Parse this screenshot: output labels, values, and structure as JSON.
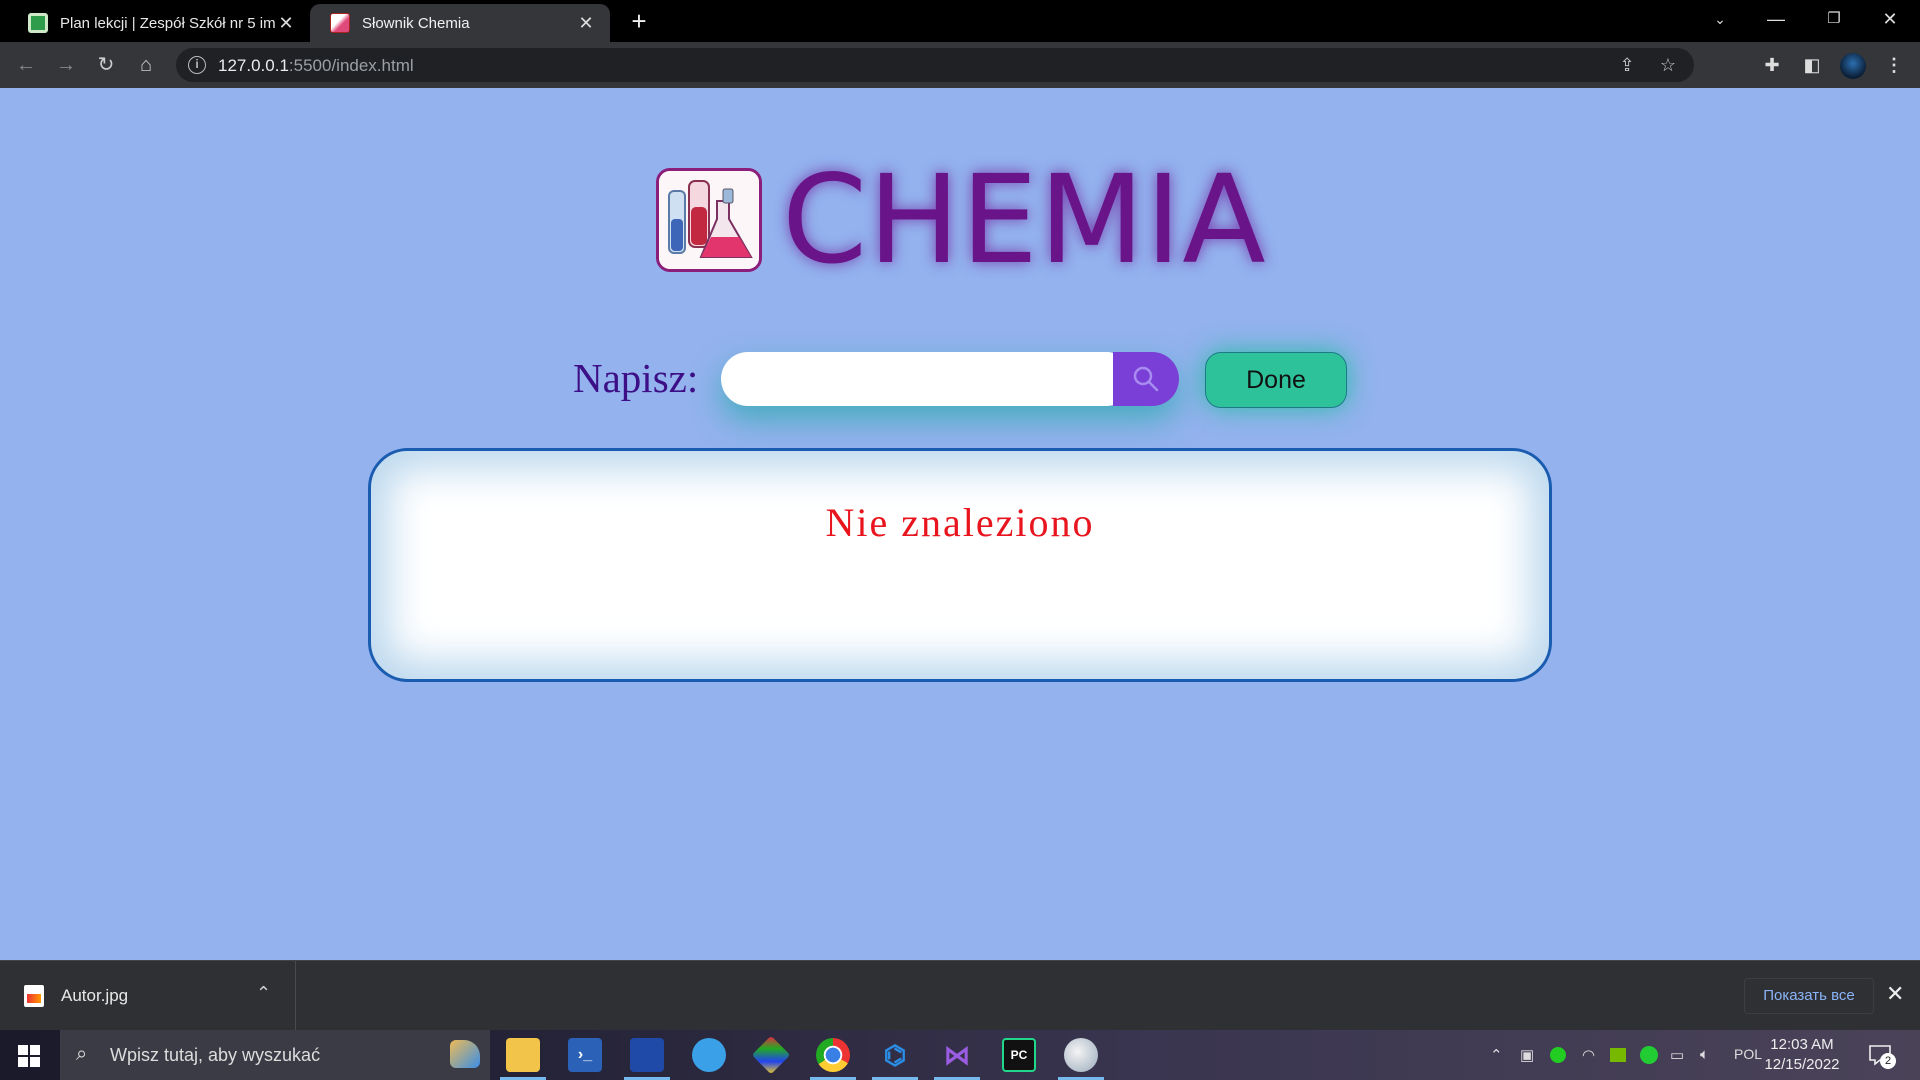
{
  "browser": {
    "tabs": [
      {
        "title": "Plan lekcji | Zespół Szkół nr 5 im.",
        "favicon": "timetable-icon",
        "active": false
      },
      {
        "title": "Słownik Chemia",
        "favicon": "chemistry-icon",
        "active": true
      }
    ],
    "address": {
      "host": "127.0.0.1",
      "rest": ":5500/index.html"
    }
  },
  "page": {
    "logo_text": "CHEMIA",
    "search_label": "Napisz:",
    "search_value": "",
    "search_placeholder": "",
    "done_label": "Done",
    "result_text": "Nie znaleziono",
    "colors": {
      "background": "#93b2ee",
      "title": "#6a148a",
      "result": "#e8141e",
      "done": "#2ec29a",
      "search_button": "#7a3fd6"
    }
  },
  "download_bar": {
    "file_name": "Autor.jpg",
    "show_all": "Показать все"
  },
  "taskbar": {
    "search_placeholder": "Wpisz tutaj, aby wyszukać",
    "apps": [
      "file-explorer-icon",
      "powershell-icon",
      "task-manager-icon",
      "magnifier-icon",
      "git-icon",
      "chrome-icon",
      "vscode-icon",
      "visual-studio-icon",
      "pycharm-icon",
      "paint-icon"
    ],
    "language": "POL",
    "time": "12:03 AM",
    "date": "12/15/2022",
    "notifications": "2"
  }
}
